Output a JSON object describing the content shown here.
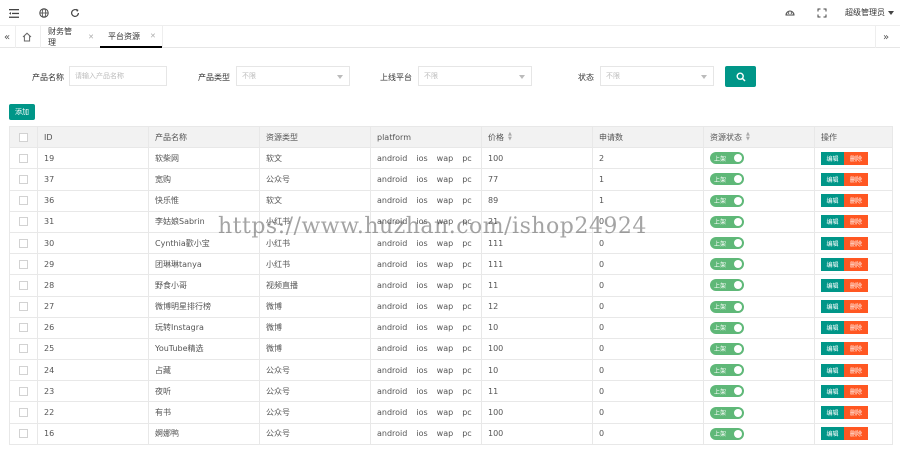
{
  "topbar": {
    "admin_label": "超级管理员"
  },
  "tabs": [
    {
      "label": "财务管理"
    },
    {
      "label": "平台资源"
    }
  ],
  "filters": {
    "name_label": "产品名称",
    "name_placeholder": "请输入产品名称",
    "type_label": "产品类型",
    "type_value": "不限",
    "platform_label": "上线平台",
    "platform_value": "不限",
    "status_label": "状态",
    "status_value": "不限"
  },
  "add_label": "添加",
  "table": {
    "headers": {
      "id": "ID",
      "name": "产品名称",
      "type": "资源类型",
      "platform": "platform",
      "price": "价格",
      "apply": "申请数",
      "status": "资源状态",
      "ops": "操作"
    },
    "platform_tags": [
      "android",
      "ios",
      "wap",
      "pc"
    ],
    "switch_label": "上架",
    "edit_label": "编辑",
    "delete_label": "删除",
    "rows": [
      {
        "id": "19",
        "name": "软柴网",
        "type": "软文",
        "price": "100",
        "apply": "2"
      },
      {
        "id": "37",
        "name": "宽购",
        "type": "公众号",
        "price": "77",
        "apply": "1"
      },
      {
        "id": "36",
        "name": "快乐惟",
        "type": "软文",
        "price": "89",
        "apply": "1"
      },
      {
        "id": "31",
        "name": "李姑娘Sabrin",
        "type": "小红书",
        "price": "21",
        "apply": "0"
      },
      {
        "id": "30",
        "name": "Cynthia歡小宝",
        "type": "小红书",
        "price": "111",
        "apply": "0"
      },
      {
        "id": "29",
        "name": "团琳琳tanya",
        "type": "小红书",
        "price": "111",
        "apply": "0"
      },
      {
        "id": "28",
        "name": "野食小哥",
        "type": "视频直播",
        "price": "11",
        "apply": "0"
      },
      {
        "id": "27",
        "name": "微博明星排行榜",
        "type": "微博",
        "price": "12",
        "apply": "0"
      },
      {
        "id": "26",
        "name": "玩转Instagra",
        "type": "微博",
        "price": "10",
        "apply": "0"
      },
      {
        "id": "25",
        "name": "YouTube精选",
        "type": "微博",
        "price": "100",
        "apply": "0"
      },
      {
        "id": "24",
        "name": "占藏",
        "type": "公众号",
        "price": "10",
        "apply": "0"
      },
      {
        "id": "23",
        "name": "夜听",
        "type": "公众号",
        "price": "11",
        "apply": "0"
      },
      {
        "id": "22",
        "name": "有书",
        "type": "公众号",
        "price": "100",
        "apply": "0"
      },
      {
        "id": "16",
        "name": "婀娜鸭",
        "type": "公众号",
        "price": "100",
        "apply": "0"
      }
    ]
  },
  "watermark": "https://www.huzhan.com/ishop24924"
}
